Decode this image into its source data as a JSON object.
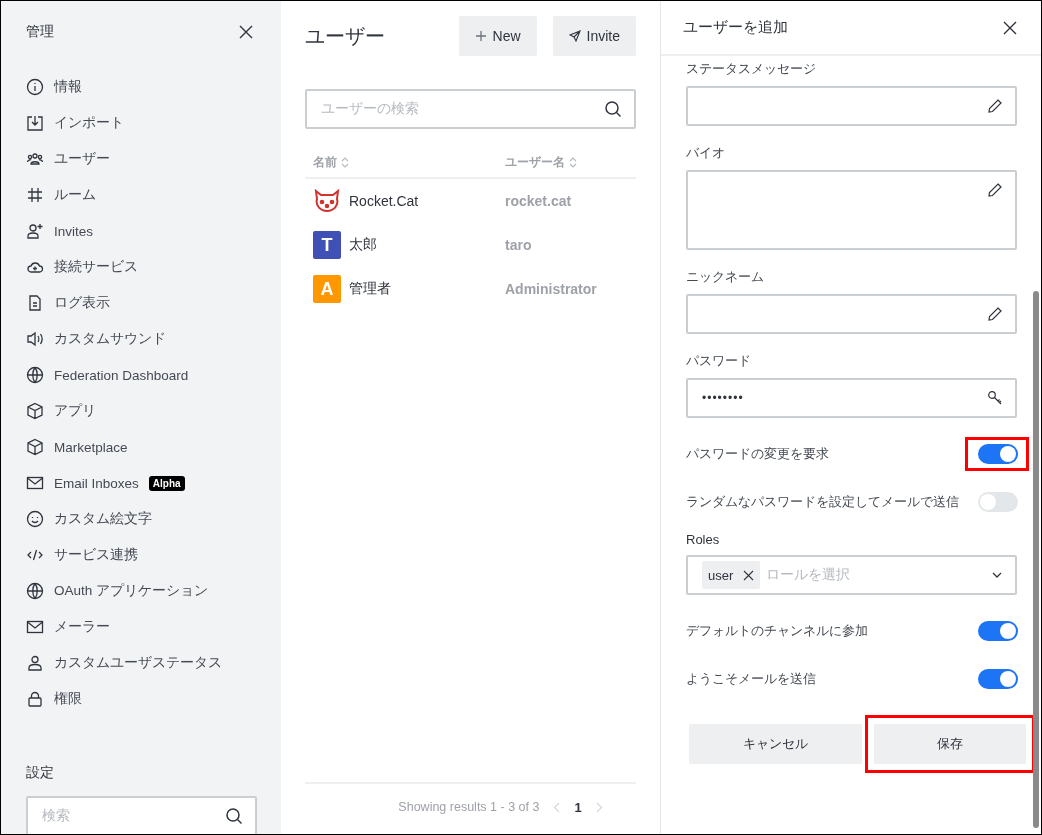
{
  "sidebar": {
    "title": "管理",
    "items": [
      {
        "label": "情報"
      },
      {
        "label": "インポート"
      },
      {
        "label": "ユーザー"
      },
      {
        "label": "ルーム"
      },
      {
        "label": "Invites"
      },
      {
        "label": "接続サービス"
      },
      {
        "label": "ログ表示"
      },
      {
        "label": "カスタムサウンド"
      },
      {
        "label": "Federation Dashboard"
      },
      {
        "label": "アプリ"
      },
      {
        "label": "Marketplace"
      },
      {
        "label": "Email Inboxes",
        "badge": "Alpha"
      },
      {
        "label": "カスタム絵文字"
      },
      {
        "label": "サービス連携"
      },
      {
        "label": "OAuth アプリケーション"
      },
      {
        "label": "メーラー"
      },
      {
        "label": "カスタムユーザステータス"
      },
      {
        "label": "権限"
      }
    ],
    "settings_label": "設定",
    "search": {
      "placeholder": "検索"
    }
  },
  "users": {
    "title": "ユーザー",
    "buttons": [
      {
        "label": "New",
        "kind": "new"
      },
      {
        "label": "Invite",
        "kind": "invite"
      }
    ],
    "search": {
      "placeholder": "ユーザーの検索"
    },
    "columns": [
      "名前",
      "ユーザー名"
    ],
    "rows": [
      {
        "name": "Rocket.Cat",
        "username": "rocket.cat",
        "avatar": {
          "kind": "cat"
        }
      },
      {
        "name": "太郎",
        "username": "taro",
        "avatar": {
          "kind": "letter",
          "letter": "T",
          "color": "#3f51b5"
        }
      },
      {
        "name": "管理者",
        "username": "Administrator",
        "avatar": {
          "kind": "letter",
          "letter": "A",
          "color": "#ff9800"
        }
      }
    ],
    "pagination": {
      "summary": "Showing results 1 - 3 of 3",
      "pages": [
        {
          "label": "1",
          "selected": true
        }
      ]
    }
  },
  "panel": {
    "title": "ユーザーを追加",
    "items": [
      {
        "kind": "text",
        "label": "ステータスメッセージ"
      },
      {
        "kind": "textarea",
        "label": "バイオ"
      },
      {
        "kind": "text",
        "label": "ニックネーム"
      },
      {
        "kind": "password",
        "label": "パスワード",
        "value": "••••••••"
      },
      {
        "kind": "toggle",
        "label": "パスワードの変更を要求",
        "on": true,
        "highlighted": true
      },
      {
        "kind": "toggle",
        "label": "ランダムなパスワードを設定してメールで送信",
        "on": false,
        "highlighted": false
      },
      {
        "kind": "select",
        "label": "Roles",
        "chips": [
          "user"
        ],
        "placeholder": "ロールを選択"
      },
      {
        "kind": "toggle",
        "label": "デフォルトのチャンネルに参加",
        "on": true,
        "highlighted": false
      },
      {
        "kind": "toggle",
        "label": "ようこそメールを送信",
        "on": true,
        "highlighted": false
      }
    ],
    "buttons": [
      {
        "label": "キャンセル",
        "highlighted": false
      },
      {
        "label": "保存",
        "highlighted": true
      }
    ]
  }
}
